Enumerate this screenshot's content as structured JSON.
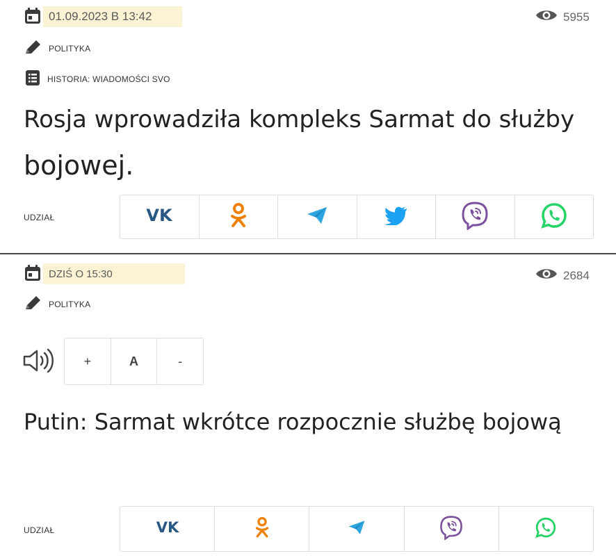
{
  "articles": [
    {
      "date": "01.09.2023 В 13:42",
      "views": "5955",
      "category": "POLITYKA",
      "series": "HISTORIA: WIADOMOŚCI SVO",
      "headline_line1": "Rosja wprowadziła kompleks Sarmat do służby",
      "headline_line2": "bojowej.",
      "share_label": "UDZIAŁ"
    },
    {
      "date": "DZIŚ O 15:30",
      "views": "2684",
      "category": "POLITYKA",
      "headline": "Putin: Sarmat wkrótce rozpocznie służbę bojową",
      "share_label": "UDZIAŁ",
      "font_controls": {
        "increase": "+",
        "reset": "A",
        "decrease": "-"
      }
    }
  ],
  "share_icons": [
    "vk-icon",
    "odnoklassniki-icon",
    "telegram-icon",
    "twitter-icon",
    "viber-icon",
    "whatsapp-icon"
  ],
  "colors": {
    "vk": "#2a5885",
    "odnoklassniki": "#ee8208",
    "telegram": "#2ca5e0",
    "twitter": "#1da1f2",
    "viber": "#7b519d",
    "whatsapp": "#25d366",
    "date_highlight": "#fbf3d3",
    "divider": "#4a4a4a"
  }
}
